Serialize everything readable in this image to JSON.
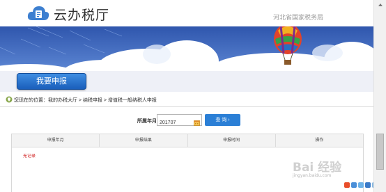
{
  "header": {
    "app_name": "云办税厅",
    "bureau": "河北省国家税务局"
  },
  "actions": {
    "apply_label": "我要申报"
  },
  "breadcrumb": {
    "text": "您现在的位置：我的办税大厅 > 纳税申报 > 增值税一般纳税人申报"
  },
  "query": {
    "label": "所属年月:",
    "period_value": "201707",
    "button_label": "查 询 ›"
  },
  "table": {
    "columns": [
      "申报年月",
      "申报结果",
      "申报时间",
      "操作"
    ],
    "empty_text": "无记录"
  },
  "watermark": {
    "brand": "Bai 经验",
    "sub": "jingyan.baidu.com"
  },
  "colors": {
    "banner_blue": "#3b63b8",
    "button_blue": "#2b7fd6",
    "alert_red": "#d02020"
  }
}
